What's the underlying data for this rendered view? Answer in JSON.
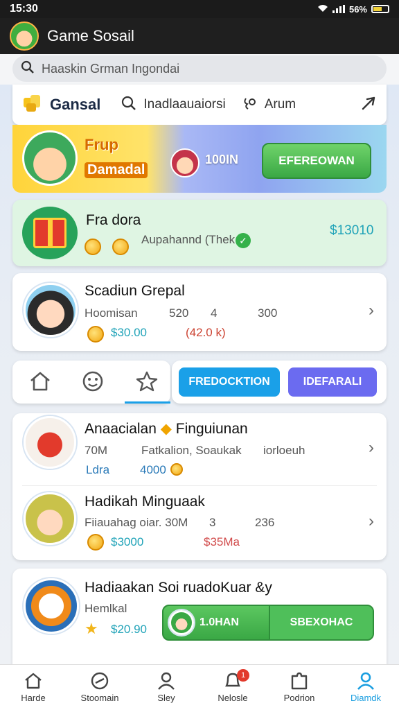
{
  "status_bar": {
    "time": "15:30",
    "battery": "56%"
  },
  "app_bar": {
    "title": "Game Sosail"
  },
  "search": {
    "placeholder": "Haaskin Grman Ingondai"
  },
  "top_tabs": {
    "brand": "Gansal",
    "tab_search": "Inadlaauaiorsi",
    "tab_forum": "Arum"
  },
  "banner": {
    "title": "Frup",
    "subtitle": "Damadal",
    "amount": "100IN",
    "cta": "EFEREOWAN"
  },
  "gift_card": {
    "title": "Fra dora",
    "subtitle": "Aupahannd (Thek",
    "amount": "$13010"
  },
  "profile": {
    "name": "Scadiun Grepal",
    "label": "Hoomisan",
    "stat1": "520",
    "stat2": "4",
    "stat3": "300",
    "money": "$30.00",
    "extra": "(42.0 k)"
  },
  "icon_tabs": [
    "home",
    "smile",
    "star"
  ],
  "action_buttons": {
    "primary": "FREDOCKTION",
    "secondary": "IDEFARALI"
  },
  "list": [
    {
      "title": "Anaacialan",
      "title2": "Finguiunan",
      "meta1": "70M",
      "meta2": "Fatkalion, Soaukak",
      "meta3": "iorloeuh",
      "sub1": "Ldra",
      "sub2": "4000"
    },
    {
      "title": "Hadikah Minguaak",
      "meta1": "Fiiauahag oiar. 30M",
      "meta2": "3",
      "meta3": "236",
      "money": "$3000",
      "money2": "$35Ma"
    }
  ],
  "bottom_card": {
    "title": "Hadiaakan Soi ruadoKuar &y",
    "subtitle": "Hemlkal",
    "amount": "$20.90",
    "bar_left": "1.0HAN",
    "bar_right": "SBEXOHAC"
  },
  "bottom_nav": [
    {
      "label": "Harde"
    },
    {
      "label": "Stoomain"
    },
    {
      "label": "Sley"
    },
    {
      "label": "Nelosle",
      "badge": "1"
    },
    {
      "label": "Podrion"
    },
    {
      "label": "Diamdk"
    }
  ],
  "colors": {
    "accent": "#1a9ee0",
    "green": "#3aa845",
    "blue_pill": "#1aa0e8",
    "purple_pill": "#6b6bf0"
  }
}
